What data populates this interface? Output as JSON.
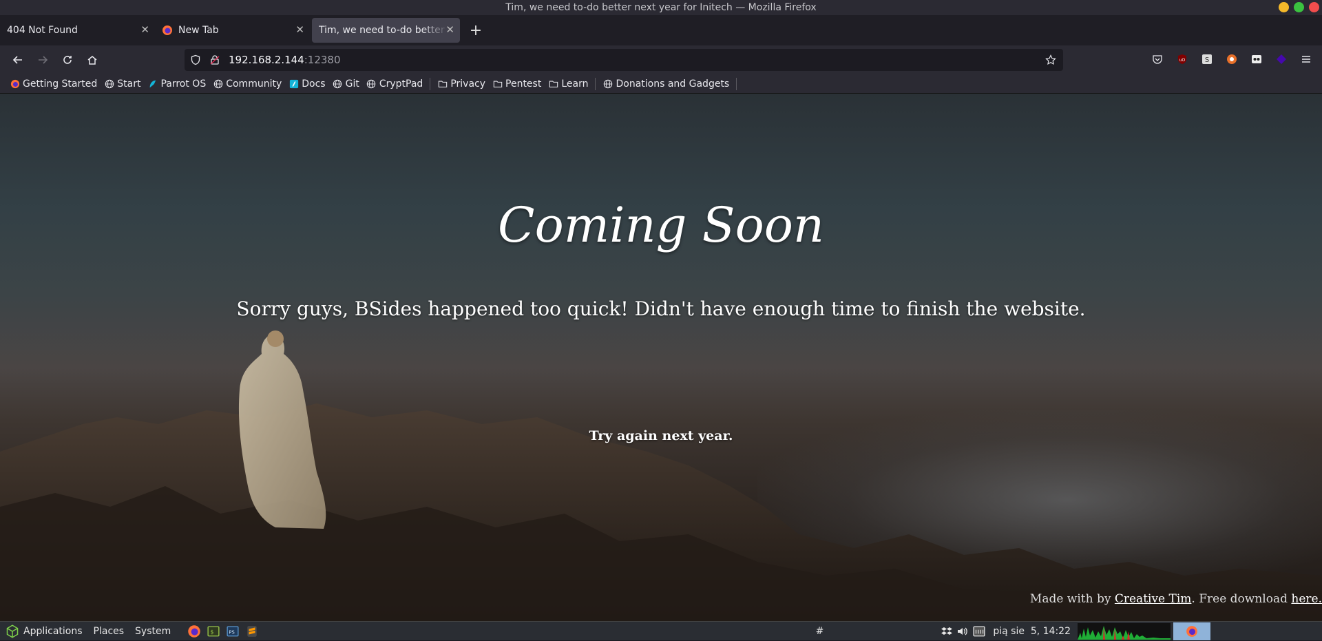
{
  "window": {
    "title": "Tim, we need to-do better next year for Initech — Mozilla Firefox"
  },
  "tabs": [
    {
      "label": "404 Not Found",
      "active": false
    },
    {
      "label": "New Tab",
      "active": false
    },
    {
      "label": "Tim, we need to-do better next year for Initech",
      "active": true
    }
  ],
  "nav": {
    "url_host": "192.168.2.144",
    "url_port": ":12380"
  },
  "bookmarks": [
    {
      "label": "Getting Started",
      "icon": "firefox-icon"
    },
    {
      "label": "Start",
      "icon": "globe-icon"
    },
    {
      "label": "Parrot OS",
      "icon": "parrot-icon"
    },
    {
      "label": "Community",
      "icon": "globe-icon"
    },
    {
      "label": "Docs",
      "icon": "docs-icon"
    },
    {
      "label": "Git",
      "icon": "globe-icon"
    },
    {
      "label": "CryptPad",
      "icon": "globe-icon"
    },
    {
      "label": "Privacy",
      "icon": "folder-icon"
    },
    {
      "label": "Pentest",
      "icon": "folder-icon"
    },
    {
      "label": "Learn",
      "icon": "folder-icon"
    },
    {
      "label": "Donations and Gadgets",
      "icon": "globe-icon"
    }
  ],
  "page": {
    "title": "Coming Soon",
    "subtitle": "Sorry guys, BSides happened too quick! Didn't have enough time to finish the website.",
    "try_again": "Try again next year.",
    "footer_prefix": "Made with by ",
    "footer_link": "Creative Tim",
    "footer_mid": ". Free download ",
    "footer_here": "here."
  },
  "taskbar": {
    "applications": "Applications",
    "places": "Places",
    "system": "System",
    "workspace": "#",
    "clock": "pią sie  5, 14:22"
  },
  "colors": {
    "wm_min": "#f5b92a",
    "wm_max": "#3bc340",
    "wm_close": "#f14d4d"
  }
}
